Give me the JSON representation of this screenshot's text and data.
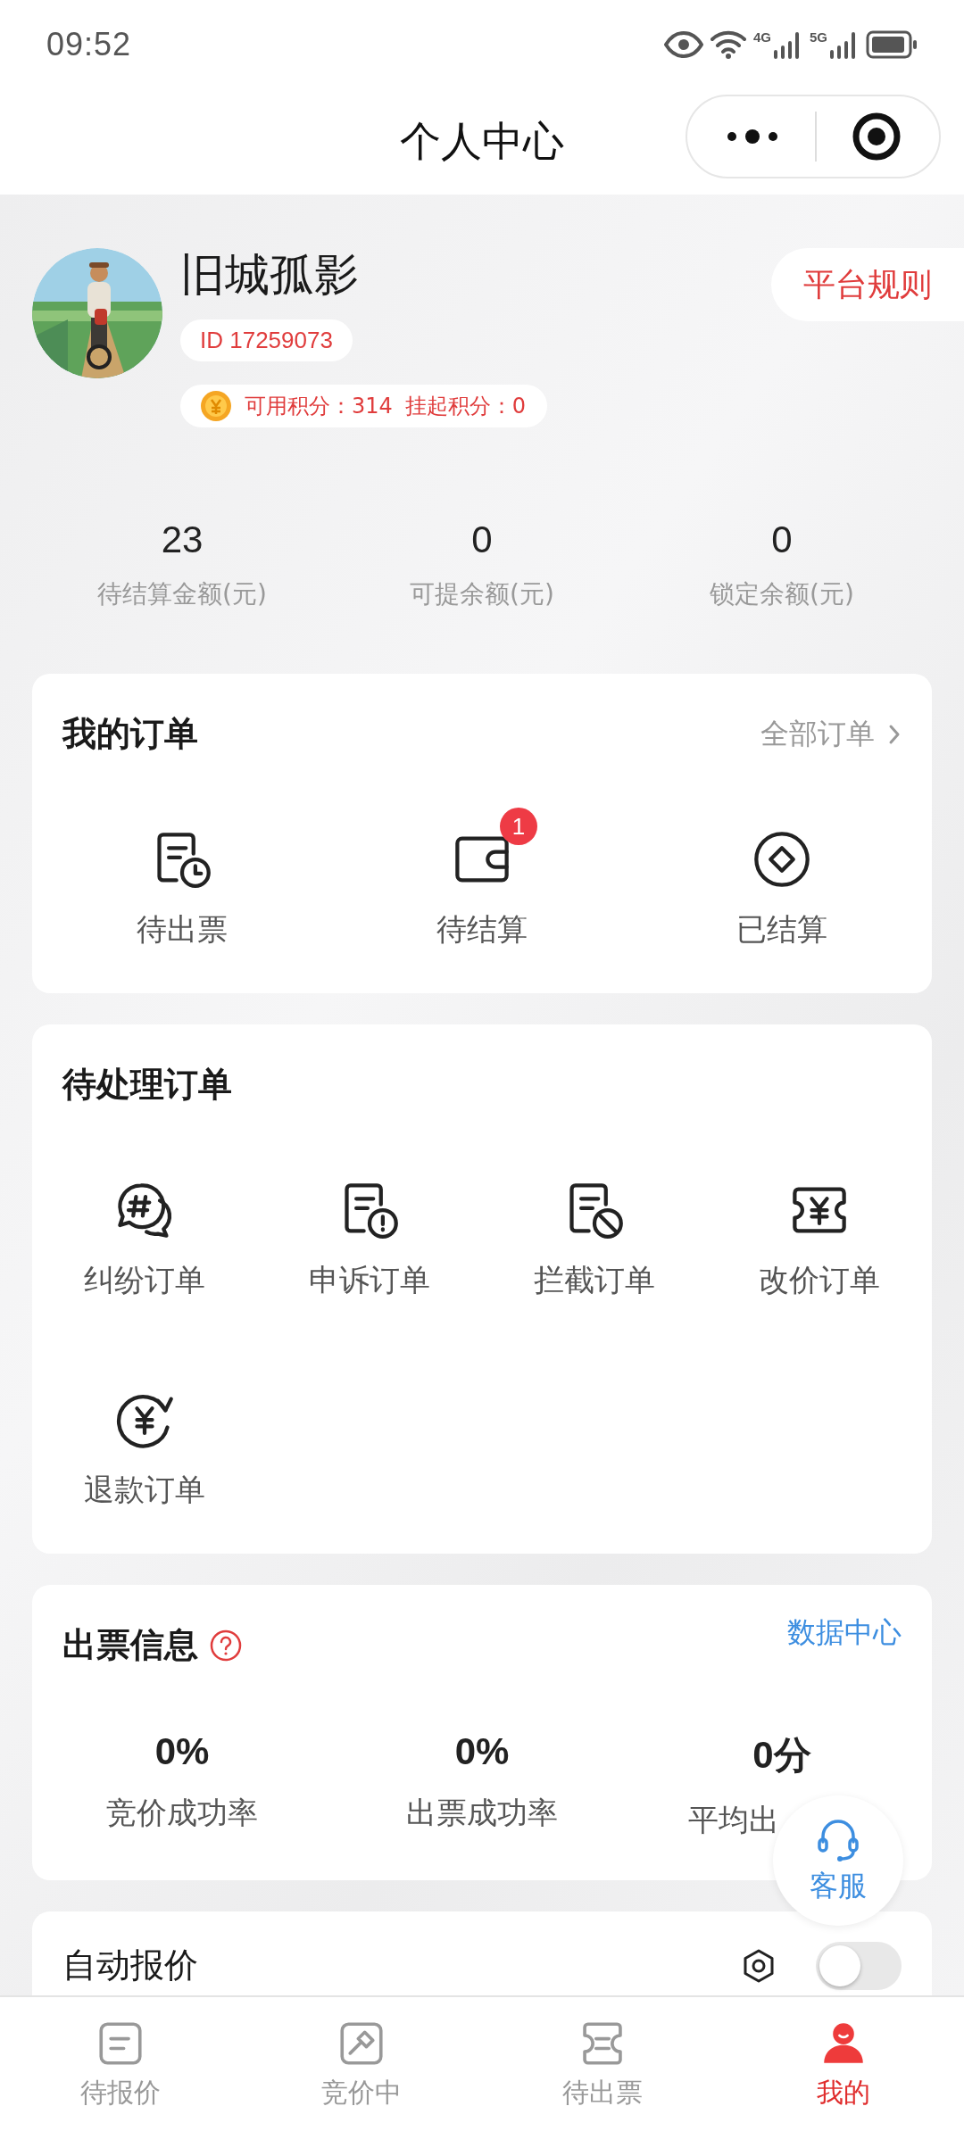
{
  "status_bar": {
    "time": "09:52",
    "network_1": "4G",
    "network_2": "5G"
  },
  "header": {
    "title": "个人中心"
  },
  "profile": {
    "name": "旧城孤影",
    "id": "ID 17259073",
    "available_points": "可用积分：314",
    "suspended_points": "挂起积分：0",
    "rules_button": "平台规则"
  },
  "balances": [
    {
      "value": "23",
      "label": "待结算金额(元)"
    },
    {
      "value": "0",
      "label": "可提余额(元)"
    },
    {
      "value": "0",
      "label": "锁定余额(元)"
    }
  ],
  "my_orders": {
    "title": "我的订单",
    "all_link": "全部订单",
    "items": [
      {
        "label": "待出票",
        "kind": "doc-clock"
      },
      {
        "label": "待结算",
        "kind": "wallet",
        "badge": "1"
      },
      {
        "label": "已结算",
        "kind": "diamond"
      }
    ]
  },
  "pending_orders": {
    "title": "待处理订单",
    "items": [
      {
        "label": "纠纷订单",
        "kind": "chat"
      },
      {
        "label": "申诉订单",
        "kind": "doc-alert"
      },
      {
        "label": "拦截订单",
        "kind": "doc-block"
      },
      {
        "label": "改价订单",
        "kind": "ticket"
      },
      {
        "label": "退款订单",
        "kind": "refund"
      }
    ]
  },
  "ticket_info": {
    "title": "出票信息",
    "data_center_link": "数据中心",
    "stats": [
      {
        "value": "0%",
        "label": "竞价成功率"
      },
      {
        "value": "0%",
        "label": "出票成功率"
      },
      {
        "value": "0分",
        "label": "平均出"
      }
    ]
  },
  "auto_quote": {
    "title": "自动报价",
    "toggle": {
      "on": false
    }
  },
  "customer_service": {
    "label": "客服"
  },
  "tab_bar": [
    {
      "label": "待报价",
      "kind": "quote",
      "selected": false
    },
    {
      "label": "竞价中",
      "kind": "bid",
      "selected": false
    },
    {
      "label": "待出票",
      "kind": "ticket",
      "selected": false
    },
    {
      "label": "我的",
      "kind": "me",
      "selected": true
    }
  ]
}
